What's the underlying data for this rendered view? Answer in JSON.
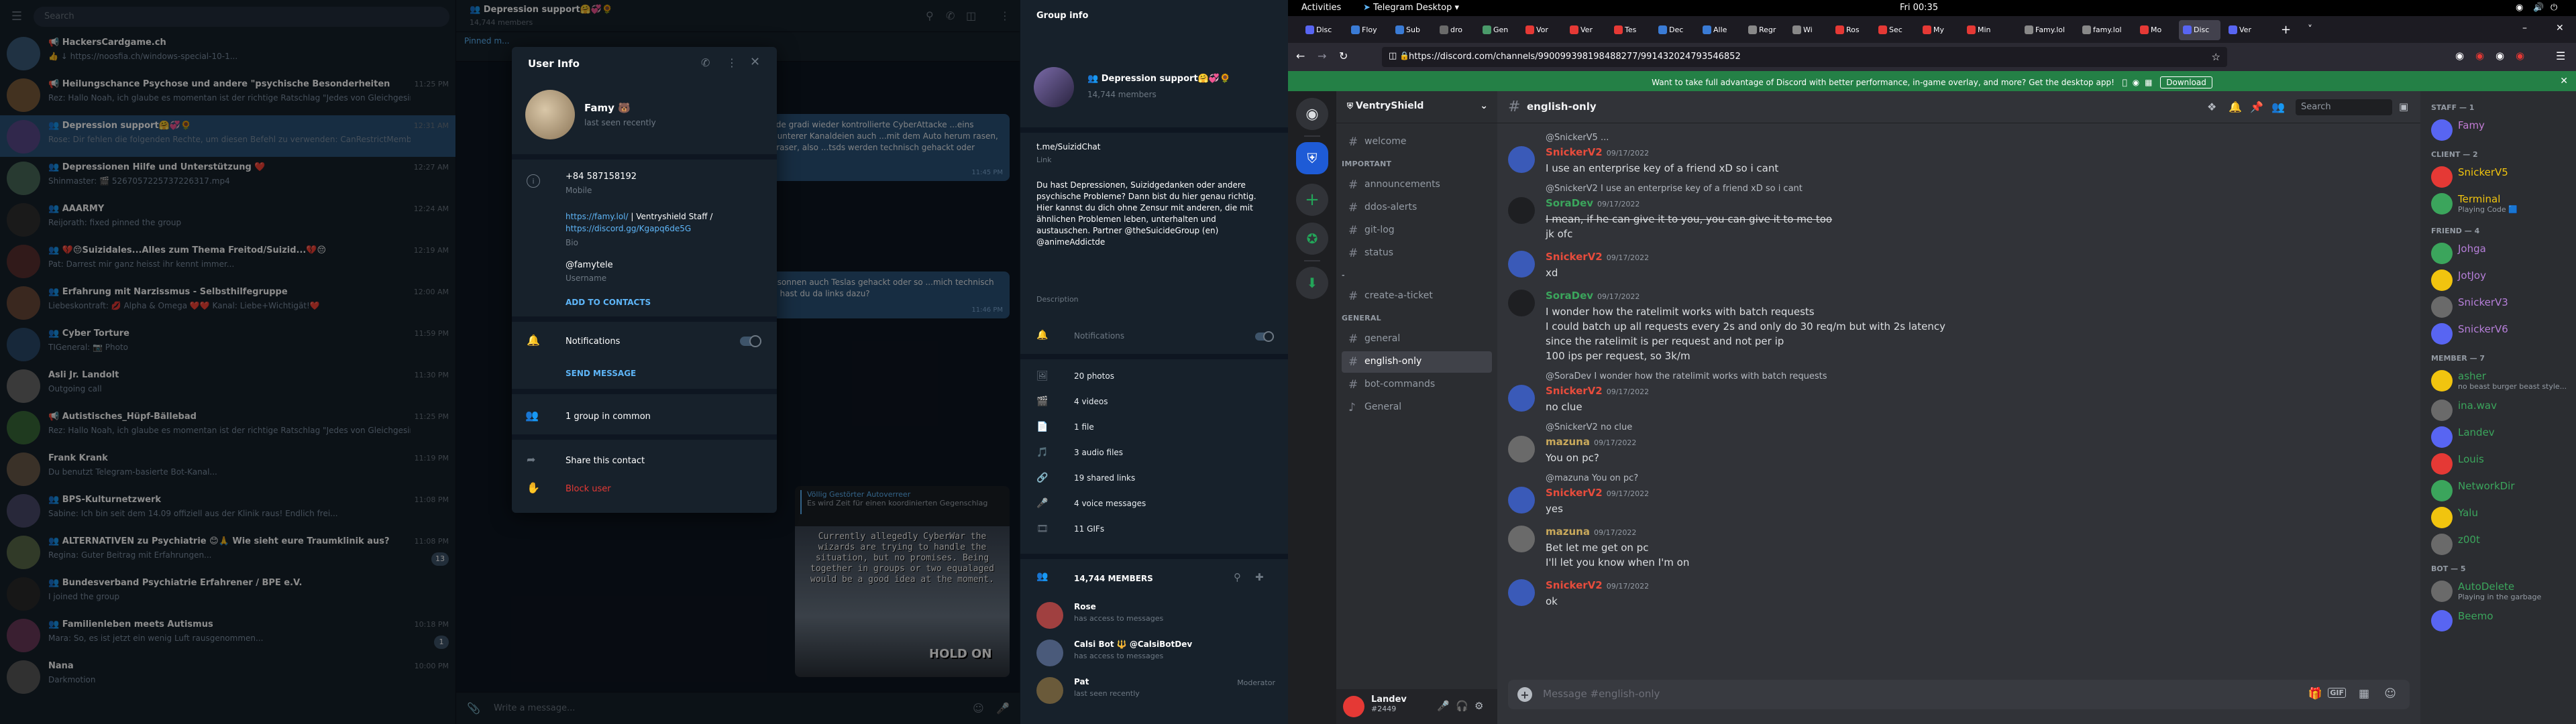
{
  "telegram": {
    "search_placeholder": "Search",
    "chats": [
      {
        "name": "📢 HackersCardgame.ch",
        "preview": "👍 ↓ https://noosfia.ch/windows-special-10-1...",
        "time": "",
        "badge": "",
        "color": "#3b5b7a"
      },
      {
        "name": "📢 Heilungschance Psychose und andere \"psychische Besonderheiten\" 💜🔥🌈🌙",
        "preview": "Rez: Hallo Noah, ich glaube es momentan ist der richtige Ratschlag \"Jedes von Gleichgesinnten ...",
        "time": "11:25 PM",
        "badge": "",
        "color": "#7a5b3b"
      },
      {
        "name": "👥 Depression support🤗💞🌻",
        "preview": "Rose: Dir fehlen die folgenden Rechte, um diesen Befehl zu verwenden: CanRestrictMembers",
        "time": "12:31 AM",
        "badge": "",
        "color": "#5a4a8a"
      },
      {
        "name": "👥 Depressionen Hilfe und Unterstützung ❤️",
        "preview": "Shinmaster: 🎬 5267057225737226317.mp4",
        "time": "12:27 AM",
        "badge": "",
        "color": "#4a6a5a"
      },
      {
        "name": "👥 AAARMY",
        "preview": "Reijorath: fixed pinned the group",
        "time": "12:24 AM",
        "badge": "",
        "color": "#303030"
      },
      {
        "name": "👥 💔😔Suizidales...Alles zum Thema Freitod/Suizid...💔😔",
        "preview": "Pat: Darrest mir ganz heisst ihr kennt immer...",
        "time": "12:19 AM",
        "badge": "",
        "color": "#5a3030"
      },
      {
        "name": "👥 Erfahrung mit Narzissmus - Selbsthilfegruppe",
        "preview": "Liebeskontraft: 💋 Alpha & Omega ❤️❤️ Kanal: Liebe+Wichtigät!❤️",
        "time": "12:00 AM",
        "badge": "",
        "color": "#6a4a3a"
      },
      {
        "name": "👥 Cyber Torture",
        "preview": "TIGeneral: 📷 Photo",
        "time": "11:59 PM",
        "badge": "",
        "color": "#2a4a6a"
      },
      {
        "name": "Asli Jr. Landolt",
        "preview": "Outgoing call",
        "time": "11:30 PM",
        "badge": "",
        "color": "#6a6a6a"
      },
      {
        "name": "📢 Autistisches_Hüpf-Bällebad",
        "preview": "Rez: Hallo Noah, ich glaube es momentan ist der richtige Ratschlag \"Jedes von Gleichgesinnten ...",
        "time": "11:25 PM",
        "badge": "",
        "color": "#3a6a3a"
      },
      {
        "name": "Frank Krank",
        "preview": "Du benutzt Telegram-basierte Bot-Kanal...",
        "time": "11:19 PM",
        "badge": "",
        "color": "#6a5a4a"
      },
      {
        "name": "👥 BPS-Kulturnetzwerk",
        "preview": "Sabine: Ich bin seit dem 14.09 offiziell aus der Klinik raus! Endlich frei...",
        "time": "11:08 PM",
        "badge": "",
        "color": "#4a4a6a"
      },
      {
        "name": "👥 ALTERNATIVEN zu Psychiatrie 😊🙏 Wie sieht eure Traumklinik aus?",
        "preview": "Regina: Guter Beitrag mit Erfahrungen...",
        "time": "11:08 PM",
        "badge": "13",
        "color": "#5a6a4a"
      },
      {
        "name": "👥 Bundesverband Psychiatrie Erfahrener / BPE e.V.",
        "preview": "I joined the group",
        "time": "",
        "badge": "",
        "color": "#2a2a2a"
      },
      {
        "name": "👥 Familienleben meets Autismus",
        "preview": "Mara: So, es ist jetzt ein wenig Luft rausgenommen...",
        "time": "10:18 PM",
        "badge": "1",
        "color": "#6a3a5a"
      },
      {
        "name": "Nana",
        "preview": "Darkmotion",
        "time": "10:00 PM",
        "badge": "",
        "color": "#5a5a5a"
      }
    ],
    "conversation": {
      "title": "👥 Depression support🤗💞🌻",
      "subtitle": "14,744 members",
      "pinned_label": "Pinned m...",
      "bubble1": "...zusicht wurde gradi wieder kontrollierte CyberAttacke ...eins Hinderniss in unterer Kanaldeien auch ...mit dem Auto herum rasen, bisher 3 Autoraser, also ...tsds werden technisch gehackt oder",
      "bubble1_time": "11:45 PM",
      "bubble2": "...sind und besonnen auch Teslas gehackt oder so ...mich technisch interessieren, hast du da links dazu?",
      "bubble2_time": "11:46 PM",
      "reply_author": "Völlig Gestörter Autoverreer",
      "reply_text": "Es wird Zeit für einen koordinierten Gegenschlag",
      "meme_text": "Currently allegedly CyberWar the wizards are trying to handle the situation, but no promises. Being together in groups or two equalaged would be a good idea at the moment.",
      "meme_caption": "HOLD ON",
      "composer_placeholder": "Write a message..."
    },
    "user_info": {
      "title": "User Info",
      "name": "Famy 🐻",
      "status": "last seen recently",
      "phone": "+84 587158192",
      "phone_label": "Mobile",
      "bio_link1": "https://famy.lol/",
      "bio_sep": " | Ventryshield Staff / ",
      "bio_link2": "https://discord.gg/Kgapq6de5G",
      "bio_label": "Bio",
      "username": "@famytele",
      "username_label": "Username",
      "add_contacts": "ADD TO CONTACTS",
      "notifications": "Notifications",
      "send_message": "SEND MESSAGE",
      "groups_common": "1 group in common",
      "share_contact": "Share this contact",
      "block_user": "Block user"
    },
    "group_info": {
      "title": "Group info",
      "name": "👥 Depression support🤗💞🌻",
      "members": "14,744 members",
      "link": "t.me/SuizidChat",
      "link_label": "Link",
      "description": "Du hast Depressionen, Suizidgedanken oder andere psychische Probleme? Dann bist du hier genau richtig. Hier kannst du dich ohne Zensur mit anderen, die mit ähnlichen Problemen leben, unterhalten und austauschen. Partner @theSuicideGroup (en) @animeAddictde",
      "description_label": "Description",
      "notifications": "Notifications",
      "media": [
        {
          "icon": "🖼",
          "label": "20 photos"
        },
        {
          "icon": "🎬",
          "label": "4 videos"
        },
        {
          "icon": "📄",
          "label": "1 file"
        },
        {
          "icon": "🎵",
          "label": "3 audio files"
        },
        {
          "icon": "🔗",
          "label": "19 shared links"
        },
        {
          "icon": "🎤",
          "label": "4 voice messages"
        },
        {
          "icon": "🎞",
          "label": "11 GIFs"
        }
      ],
      "members_header": "14,744 MEMBERS",
      "member_list": [
        {
          "name": "Rose",
          "status": "has access to messages",
          "role": "",
          "color": "#a04040"
        },
        {
          "name": "Calsi Bot 🔱 @CalsiBotDev",
          "status": "has access to messages",
          "role": "",
          "color": "#4a5a7a"
        },
        {
          "name": "Pat",
          "status": "last seen recently",
          "role": "Moderator",
          "color": "#6a5a3a"
        }
      ]
    }
  },
  "gnome": {
    "activities": "Activities",
    "app": "Telegram Desktop",
    "clock": "Fri 00:35"
  },
  "browser": {
    "tabs": [
      "Disc",
      "Floy",
      "Sub",
      "dro",
      "Gen",
      "Vor",
      "Ver",
      "Tes",
      "Dec",
      "Alle",
      "Regr",
      "Wi",
      "Ros",
      "Sec",
      "My",
      "Min",
      "Famy.lol",
      "famy.lol",
      "Mo",
      "Disc",
      "Ver"
    ],
    "url": "https://discord.com/channels/990099398198488277/991432024793546852",
    "banner_text": "Want to take full advantage of Discord with better performance, in-game overlay, and more? Get the desktop app!",
    "banner_button": "Download"
  },
  "discord": {
    "server_name": "VentryShield",
    "channels": [
      {
        "type": "plain",
        "name": "welcome",
        "active": false
      },
      {
        "type": "cat",
        "name": "IMPORTANT"
      },
      {
        "type": "plain",
        "name": "announcements",
        "active": false
      },
      {
        "type": "plain",
        "name": "ddos-alerts",
        "active": false
      },
      {
        "type": "plain",
        "name": "git-log",
        "active": false
      },
      {
        "type": "plain",
        "name": "status",
        "active": false
      },
      {
        "type": "cat",
        "name": "-"
      },
      {
        "type": "plain",
        "name": "create-a-ticket",
        "active": false
      },
      {
        "type": "cat",
        "name": "GENERAL"
      },
      {
        "type": "plain",
        "name": "general",
        "active": false
      },
      {
        "type": "plain",
        "name": "english-only",
        "active": true
      },
      {
        "type": "plain",
        "name": "bot-commands",
        "active": false
      },
      {
        "type": "voice",
        "name": "General",
        "active": false
      }
    ],
    "channel_title": "english-only",
    "search_placeholder": "Search",
    "messages": [
      {
        "kind": "reply",
        "text": "@SnickerV5 ..."
      },
      {
        "kind": "msg",
        "user": "SnickerV2",
        "ucolor": "#e74c3c",
        "time": "09/17/2022",
        "lines": [
          "I use an enterprise key of a friend xD so i cant"
        ]
      },
      {
        "kind": "reply",
        "text": "@SnickerV2 I use an enterprise key of a friend xD so i cant"
      },
      {
        "kind": "msg",
        "user": "SoraDev",
        "ucolor": "#3ba55c",
        "time": "09/17/2022",
        "lines": [
          "I mean, if he can give it to you, you can give it to me too",
          "jk ofc"
        ]
      },
      {
        "kind": "msg",
        "user": "SnickerV2",
        "ucolor": "#e74c3c",
        "time": "09/17/2022",
        "lines": [
          "xd"
        ]
      },
      {
        "kind": "msg",
        "user": "SoraDev",
        "ucolor": "#3ba55c",
        "time": "09/17/2022",
        "lines": [
          "I wonder how the ratelimit works with batch requests",
          "I could batch up all requests every 2s and only do 30 req/m but with 2s latency",
          "since the ratelimit is per request and not per ip",
          "100 ips per request, so 3k/m"
        ]
      },
      {
        "kind": "reply",
        "text": "@SoraDev I wonder how the ratelimit works with batch requests"
      },
      {
        "kind": "msg",
        "user": "SnickerV2",
        "ucolor": "#e74c3c",
        "time": "09/17/2022",
        "lines": [
          "no clue"
        ]
      },
      {
        "kind": "reply",
        "text": "@SnickerV2 no clue"
      },
      {
        "kind": "msg",
        "user": "mazuna",
        "ucolor": "#c9a95b",
        "time": "09/17/2022",
        "lines": [
          "You on pc?"
        ]
      },
      {
        "kind": "reply",
        "text": "@mazuna You on pc?"
      },
      {
        "kind": "msg",
        "user": "SnickerV2",
        "ucolor": "#e74c3c",
        "time": "09/17/2022",
        "lines": [
          "yes"
        ]
      },
      {
        "kind": "msg",
        "user": "mazuna",
        "ucolor": "#c9a95b",
        "time": "09/17/2022",
        "lines": [
          "Bet let me get on pc",
          "I'll let you know when I'm on"
        ]
      },
      {
        "kind": "msg",
        "user": "SnickerV2",
        "ucolor": "#e74c3c",
        "time": "09/17/2022",
        "lines": [
          "ok"
        ]
      }
    ],
    "composer_placeholder": "Message #english-only",
    "member_groups": [
      {
        "label": "STAFF — 1",
        "members": [
          {
            "name": "Famy",
            "activity": "",
            "color": "#c27cd4"
          }
        ]
      },
      {
        "label": "CLIENT — 2",
        "members": [
          {
            "name": "SnickerV5",
            "activity": "",
            "color": "#f1c40f"
          },
          {
            "name": "Terminal",
            "activity": "Playing Code 🟦",
            "color": "#f1c40f"
          }
        ]
      },
      {
        "label": "FRIEND — 4",
        "members": [
          {
            "name": "Johga",
            "activity": "",
            "color": "#b67fd9"
          },
          {
            "name": "JotJoy",
            "activity": "",
            "color": "#b67fd9"
          },
          {
            "name": "SnickerV3",
            "activity": "",
            "color": "#b67fd9"
          },
          {
            "name": "SnickerV6",
            "activity": "",
            "color": "#b67fd9"
          }
        ]
      },
      {
        "label": "MEMBER — 7",
        "members": [
          {
            "name": "asher",
            "activity": "no beast burger beast style...",
            "color": "#3ba55c"
          },
          {
            "name": "ina.wav",
            "activity": "",
            "color": "#3ba55c"
          },
          {
            "name": "Landev",
            "activity": "",
            "color": "#3ba55c"
          },
          {
            "name": "Louis",
            "activity": "",
            "color": "#3ba55c"
          },
          {
            "name": "NetworkDir",
            "activity": "",
            "color": "#3ba55c"
          },
          {
            "name": "Yalu",
            "activity": "",
            "color": "#3ba55c"
          },
          {
            "name": "z00t",
            "activity": "",
            "color": "#3ba55c"
          }
        ]
      },
      {
        "label": "BOT — 5",
        "members": [
          {
            "name": "AutoDelete",
            "activity": "Playing in the garbage",
            "color": "#3ba55c"
          },
          {
            "name": "Beemo",
            "activity": "",
            "color": "#3ba55c"
          }
        ]
      }
    ],
    "user": {
      "name": "Landev",
      "tag": "#2449"
    }
  }
}
